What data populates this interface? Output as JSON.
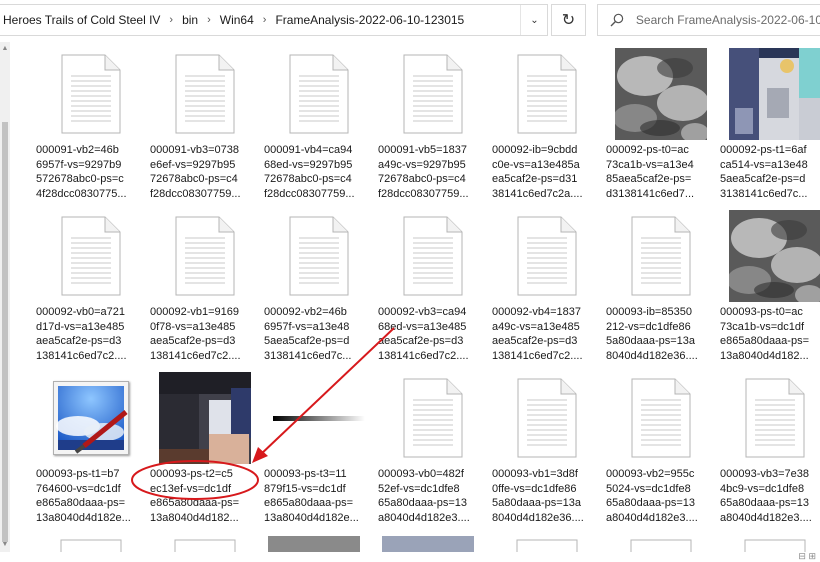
{
  "breadcrumb": [
    "Heroes Trails of Cold Steel IV",
    "bin",
    "Win64",
    "FrameAnalysis-2022-06-10-123015"
  ],
  "breadcrumb_separator": "›",
  "search": {
    "placeholder": "Search FrameAnalysis-2022-06-10-..."
  },
  "files": [
    {
      "type": "doc",
      "label": "000091-vb2=46b\n6957f-vs=9297b9\n572678abc0-ps=c\n4f28dcc0830775..."
    },
    {
      "type": "doc",
      "label": "000091-vb3=0738\ne6ef-vs=9297b95\n72678abc0-ps=c4\nf28dcc08307759..."
    },
    {
      "type": "doc",
      "label": "000091-vb4=ca94\n68ed-vs=9297b95\n72678abc0-ps=c4\nf28dcc08307759..."
    },
    {
      "type": "doc",
      "label": "000091-vb5=1837\na49c-vs=9297b95\n72678abc0-ps=c4\nf28dcc08307759..."
    },
    {
      "type": "doc",
      "label": "000092-ib=9cbdd\nc0e-vs=a13e485a\nea5caf2e-ps=d31\n38141c6ed7c2a...."
    },
    {
      "type": "cloud",
      "label": "000092-ps-t0=ac\n73ca1b-vs=a13e4\n85aea5caf2e-ps=\nd3138141c6ed7..."
    },
    {
      "type": "art",
      "label": "000092-ps-t1=6af\nca514-vs=a13e48\n5aea5caf2e-ps=d\n3138141c6ed7c..."
    },
    {
      "type": "doc",
      "label": "000092-vb0=a721\nd17d-vs=a13e485\naea5caf2e-ps=d3\n138141c6ed7c2...."
    },
    {
      "type": "doc",
      "label": "000092-vb1=9169\n0f78-vs=a13e485\naea5caf2e-ps=d3\n138141c6ed7c2...."
    },
    {
      "type": "doc",
      "label": "000092-vb2=46b\n6957f-vs=a13e48\n5aea5caf2e-ps=d\n3138141c6ed7c..."
    },
    {
      "type": "doc",
      "label": "000092-vb3=ca94\n68ed-vs=a13e485\naea5caf2e-ps=d3\n138141c6ed7c2...."
    },
    {
      "type": "doc",
      "label": "000092-vb4=1837\na49c-vs=a13e485\naea5caf2e-ps=d3\n138141c6ed7c2...."
    },
    {
      "type": "doc",
      "label": "000093-ib=85350\n212-vs=dc1dfe86\n5a80daaa-ps=13a\n8040d4d182e36...."
    },
    {
      "type": "cloud",
      "label": "000093-ps-t0=ac\n73ca1b-vs=dc1df\ne865a80daaa-ps=\n13a8040d4d182..."
    },
    {
      "type": "paint",
      "label": "000093-ps-t1=b7\n764600-vs=dc1df\ne865a80daaa-ps=\n13a8040d4d182e..."
    },
    {
      "type": "boots",
      "label": "000093-ps-t2=c5\nec13ef-vs=dc1df\ne865a80daaa-ps=\n13a8040d4d182..."
    },
    {
      "type": "ramp",
      "label": "000093-ps-t3=11\n879f15-vs=dc1df\ne865a80daaa-ps=\n13a8040d4d182e..."
    },
    {
      "type": "doc",
      "label": "000093-vb0=482f\n52ef-vs=dc1dfe8\n65a80daaa-ps=13\na8040d4d182e3...."
    },
    {
      "type": "doc",
      "label": "000093-vb1=3d8f\n0ffe-vs=dc1dfe86\n5a80daaa-ps=13a\n8040d4d182e36...."
    },
    {
      "type": "doc",
      "label": "000093-vb2=955c\n5024-vs=dc1dfe8\n65a80daaa-ps=13\na8040d4d182e3...."
    },
    {
      "type": "doc",
      "label": "000093-vb3=7e38\n4bc9-vs=dc1dfe8\n65a80daaa-ps=13\na8040d4d182e3...."
    }
  ],
  "colors": {
    "annotation": "#d7191c",
    "scroll_thumb": "#c2c2c2"
  }
}
